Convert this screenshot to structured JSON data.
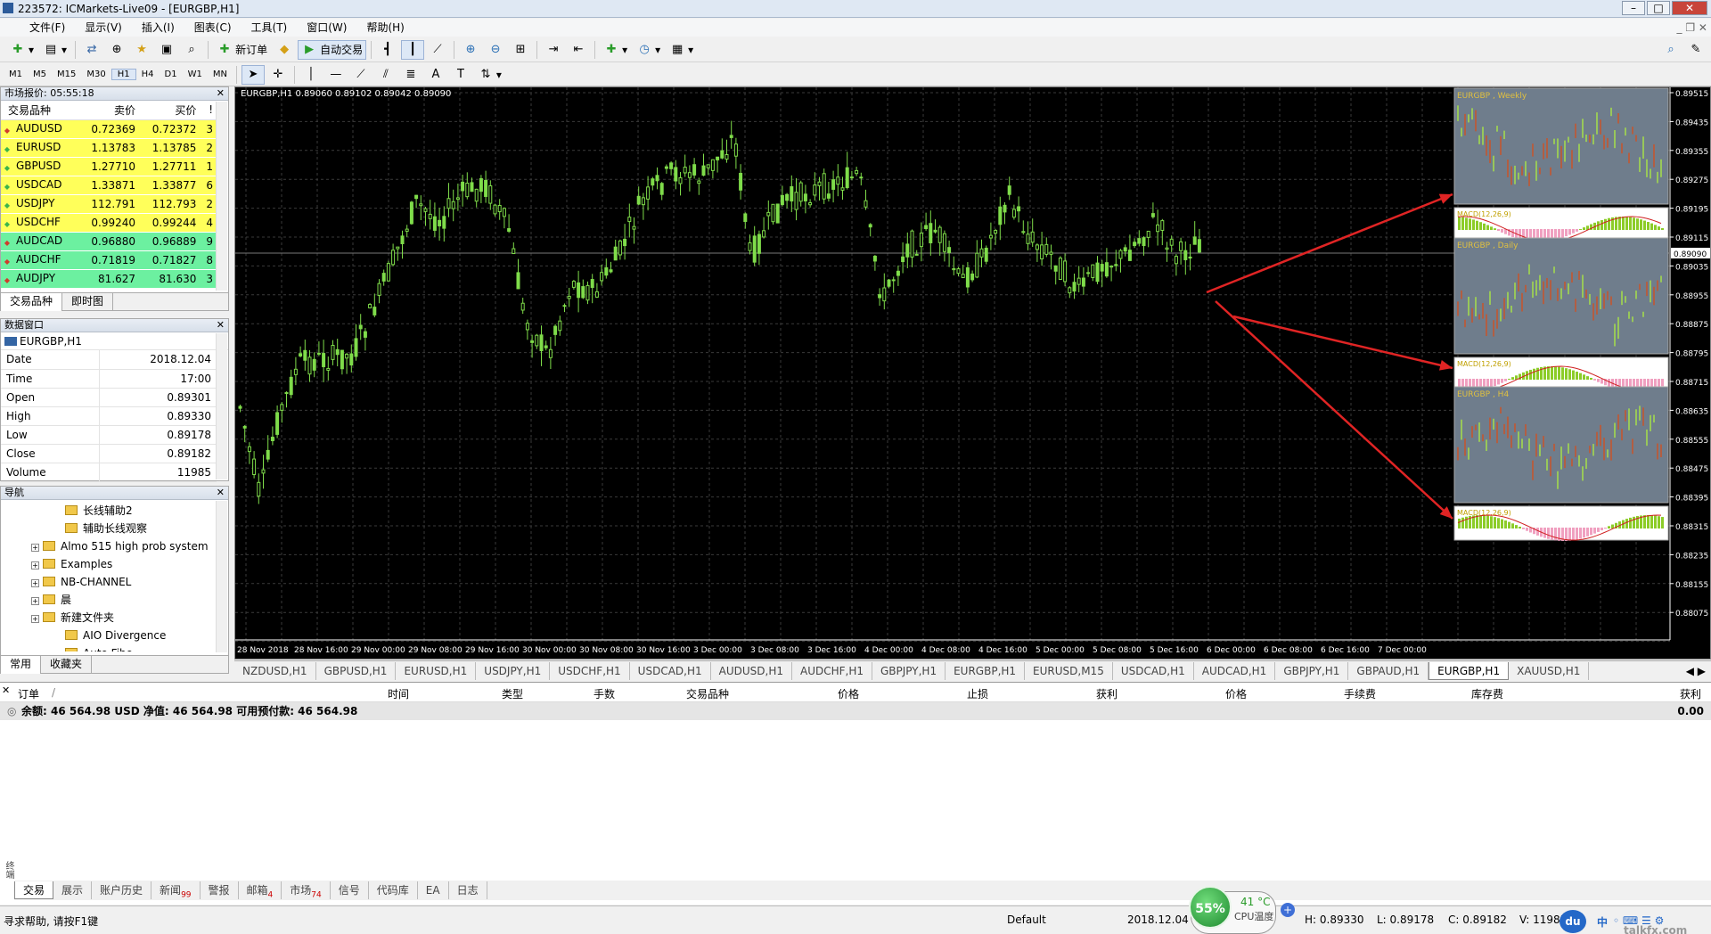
{
  "title": "223572: ICMarkets-Live09 - [EURGBP,H1]",
  "menu": [
    "文件(F)",
    "显示(V)",
    "插入(I)",
    "图表(C)",
    "工具(T)",
    "窗口(W)",
    "帮助(H)"
  ],
  "toolbar": {
    "new_order": "新订单",
    "auto_trading": "自动交易"
  },
  "timeframes": [
    "M1",
    "M5",
    "M15",
    "M30",
    "H1",
    "H4",
    "D1",
    "W1",
    "MN"
  ],
  "market_watch": {
    "title": "市场报价: 05:55:18",
    "cols": [
      "交易品种",
      "卖价",
      "买价",
      "!"
    ],
    "rows": [
      {
        "sym": "AUDUSD",
        "bid": "0.72369",
        "ask": "0.72372",
        "sp": "3",
        "color": "y",
        "dir": "dn"
      },
      {
        "sym": "EURUSD",
        "bid": "1.13783",
        "ask": "1.13785",
        "sp": "2",
        "color": "y",
        "dir": "up"
      },
      {
        "sym": "GBPUSD",
        "bid": "1.27710",
        "ask": "1.27711",
        "sp": "1",
        "color": "y",
        "dir": "up"
      },
      {
        "sym": "USDCAD",
        "bid": "1.33871",
        "ask": "1.33877",
        "sp": "6",
        "color": "y",
        "dir": "up"
      },
      {
        "sym": "USDJPY",
        "bid": "112.791",
        "ask": "112.793",
        "sp": "2",
        "color": "y",
        "dir": "up"
      },
      {
        "sym": "USDCHF",
        "bid": "0.99240",
        "ask": "0.99244",
        "sp": "4",
        "color": "y",
        "dir": "up"
      },
      {
        "sym": "AUDCAD",
        "bid": "0.96880",
        "ask": "0.96889",
        "sp": "9",
        "color": "g",
        "dir": "dn"
      },
      {
        "sym": "AUDCHF",
        "bid": "0.71819",
        "ask": "0.71827",
        "sp": "8",
        "color": "g",
        "dir": "dn"
      },
      {
        "sym": "AUDJPY",
        "bid": "81.627",
        "ask": "81.630",
        "sp": "3",
        "color": "g",
        "dir": "dn"
      }
    ],
    "tabs": [
      "交易品种",
      "即时图"
    ]
  },
  "data_window": {
    "title": "数据窗口",
    "symbol": "EURGBP,H1",
    "rows": [
      {
        "k": "Date",
        "v": "2018.12.04"
      },
      {
        "k": "Time",
        "v": "17:00"
      },
      {
        "k": "Open",
        "v": "0.89301"
      },
      {
        "k": "High",
        "v": "0.89330"
      },
      {
        "k": "Low",
        "v": "0.89178"
      },
      {
        "k": "Close",
        "v": "0.89182"
      },
      {
        "k": "Volume",
        "v": "11985"
      }
    ]
  },
  "navigator": {
    "title": "导航",
    "items": [
      {
        "label": "长线辅助2",
        "indent": 2,
        "exp": false
      },
      {
        "label": "辅助长线观察",
        "indent": 2,
        "exp": false
      },
      {
        "label": "Almo 515 high prob system",
        "indent": 1,
        "exp": true
      },
      {
        "label": "Examples",
        "indent": 1,
        "exp": true
      },
      {
        "label": "NB-CHANNEL",
        "indent": 1,
        "exp": true
      },
      {
        "label": "晨",
        "indent": 1,
        "exp": true
      },
      {
        "label": "新建文件夹",
        "indent": 1,
        "exp": true
      },
      {
        "label": "AIO Divergence",
        "indent": 2,
        "exp": false
      },
      {
        "label": "Auto Fibo",
        "indent": 2,
        "exp": false
      }
    ],
    "tabs": [
      "常用",
      "收藏夹"
    ]
  },
  "chart": {
    "header": "EURGBP,H1  0.89060 0.89102 0.89042 0.89090",
    "current_price": "0.89090",
    "price_labels": [
      "0.89515",
      "0.89435",
      "0.89355",
      "0.89275",
      "0.89195",
      "0.89115",
      "0.89035",
      "0.88955",
      "0.88875",
      "0.88795",
      "0.88715",
      "0.88635",
      "0.88555",
      "0.88475",
      "0.88395",
      "0.88315",
      "0.88235",
      "0.88155",
      "0.88075"
    ],
    "time_labels": [
      "28 Nov 2018",
      "28 Nov 16:00",
      "29 Nov 00:00",
      "29 Nov 08:00",
      "29 Nov 16:00",
      "30 Nov 00:00",
      "30 Nov 08:00",
      "30 Nov 16:00",
      "3 Dec 00:00",
      "3 Dec 08:00",
      "3 Dec 16:00",
      "4 Dec 00:00",
      "4 Dec 08:00",
      "4 Dec 16:00",
      "5 Dec 00:00",
      "5 Dec 08:00",
      "5 Dec 16:00",
      "6 Dec 00:00",
      "6 Dec 08:00",
      "6 Dec 16:00",
      "7 Dec 00:00"
    ],
    "mini_charts": [
      {
        "label": "EURGBP , Weekly",
        "macd": "MACD(12,26,9)"
      },
      {
        "label": "EURGBP , Daily",
        "macd": "MACD(12,26,9)"
      },
      {
        "label": "EURGBP , H4",
        "macd": "MACD(12,26,9)"
      }
    ],
    "colors": {
      "bg": "#000000",
      "candle": "#7fdc4a",
      "grid": "#3a3a3a",
      "mini_bg": "#6f7d8c",
      "arrow": "#e02424"
    }
  },
  "chart_tabs": [
    "NZDUSD,H1",
    "GBPUSD,H1",
    "EURUSD,H1",
    "USDJPY,H1",
    "USDCHF,H1",
    "USDCAD,H1",
    "AUDUSD,H1",
    "AUDCHF,H1",
    "GBPJPY,H1",
    "EURGBP,H1",
    "EURUSD,M15",
    "USDCAD,H1",
    "AUDCAD,H1",
    "GBPJPY,H1",
    "GBPAUD,H1",
    "EURGBP,H1",
    "XAUUSD,H1"
  ],
  "active_chart_tab": 15,
  "terminal": {
    "cols": [
      "订单",
      "/",
      "时间",
      "类型",
      "手数",
      "交易品种",
      "价格",
      "止损",
      "获利",
      "价格",
      "手续费",
      "库存费",
      "获利"
    ],
    "balance": "余额: 46 564.98 USD  净值: 46 564.98  可用预付款: 46 564.98",
    "balance_value": "0.00",
    "tabs": [
      {
        "label": "交易",
        "badge": ""
      },
      {
        "label": "展示",
        "badge": ""
      },
      {
        "label": "账户历史",
        "badge": ""
      },
      {
        "label": "新闻",
        "badge": "99"
      },
      {
        "label": "警报",
        "badge": ""
      },
      {
        "label": "邮箱",
        "badge": "4"
      },
      {
        "label": "市场",
        "badge": "74"
      },
      {
        "label": "信号",
        "badge": ""
      },
      {
        "label": "代码库",
        "badge": ""
      },
      {
        "label": "EA",
        "badge": ""
      },
      {
        "label": "日志",
        "badge": ""
      }
    ]
  },
  "status": {
    "help": "寻求帮助, 请按F1键",
    "profile": "Default",
    "datetime": "2018.12.04 1",
    "high": "H: 0.89330",
    "low": "L: 0.89178",
    "close": "C: 0.89182",
    "volume": "V: 11985",
    "cpu_pct": "55%",
    "cpu_temp": "41 °C",
    "cpu_label": "CPU温度",
    "watermark": "talkfx.com",
    "du": "du",
    "ime": "中"
  }
}
